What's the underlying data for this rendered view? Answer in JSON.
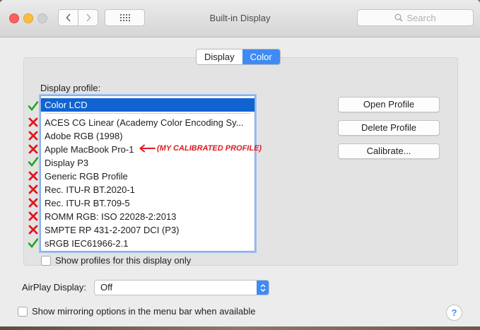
{
  "window": {
    "title": "Built-in Display"
  },
  "search": {
    "placeholder": "Search"
  },
  "tabs": [
    {
      "label": "Display",
      "active": false
    },
    {
      "label": "Color",
      "active": true
    }
  ],
  "profile_section": {
    "label": "Display profile:",
    "profiles": [
      {
        "name": "Color LCD",
        "selected": true,
        "mark": "check"
      },
      {
        "name": "ACES CG Linear (Academy Color Encoding Sy...",
        "selected": false,
        "mark": "cross"
      },
      {
        "name": "Adobe RGB (1998)",
        "selected": false,
        "mark": "cross"
      },
      {
        "name": "Apple MacBook Pro-1",
        "selected": false,
        "mark": "cross"
      },
      {
        "name": "Display P3",
        "selected": false,
        "mark": "check"
      },
      {
        "name": "Generic RGB Profile",
        "selected": false,
        "mark": "cross"
      },
      {
        "name": "Rec. ITU-R BT.2020-1",
        "selected": false,
        "mark": "cross"
      },
      {
        "name": "Rec. ITU-R BT.709-5",
        "selected": false,
        "mark": "cross"
      },
      {
        "name": "ROMM RGB: ISO 22028-2:2013",
        "selected": false,
        "mark": "cross"
      },
      {
        "name": "SMPTE RP 431-2-2007 DCI (P3)",
        "selected": false,
        "mark": "cross"
      },
      {
        "name": "sRGB IEC61966-2.1",
        "selected": false,
        "mark": "check"
      }
    ],
    "annotation": "(MY CALIBRATED PROFILE)",
    "show_only_checkbox": {
      "label": "Show profiles for this display only",
      "checked": false
    }
  },
  "buttons": {
    "open": "Open Profile",
    "delete": "Delete Profile",
    "calibrate": "Calibrate..."
  },
  "airplay": {
    "label": "AirPlay Display:",
    "value": "Off"
  },
  "mirroring_checkbox": {
    "label": "Show mirroring options in the menu bar when available",
    "checked": false
  },
  "help": {
    "label": "?"
  },
  "colors": {
    "accent": "#3f8bf5",
    "selection": "#1163d1",
    "check": "#1fa81f",
    "cross": "#e0191f"
  }
}
